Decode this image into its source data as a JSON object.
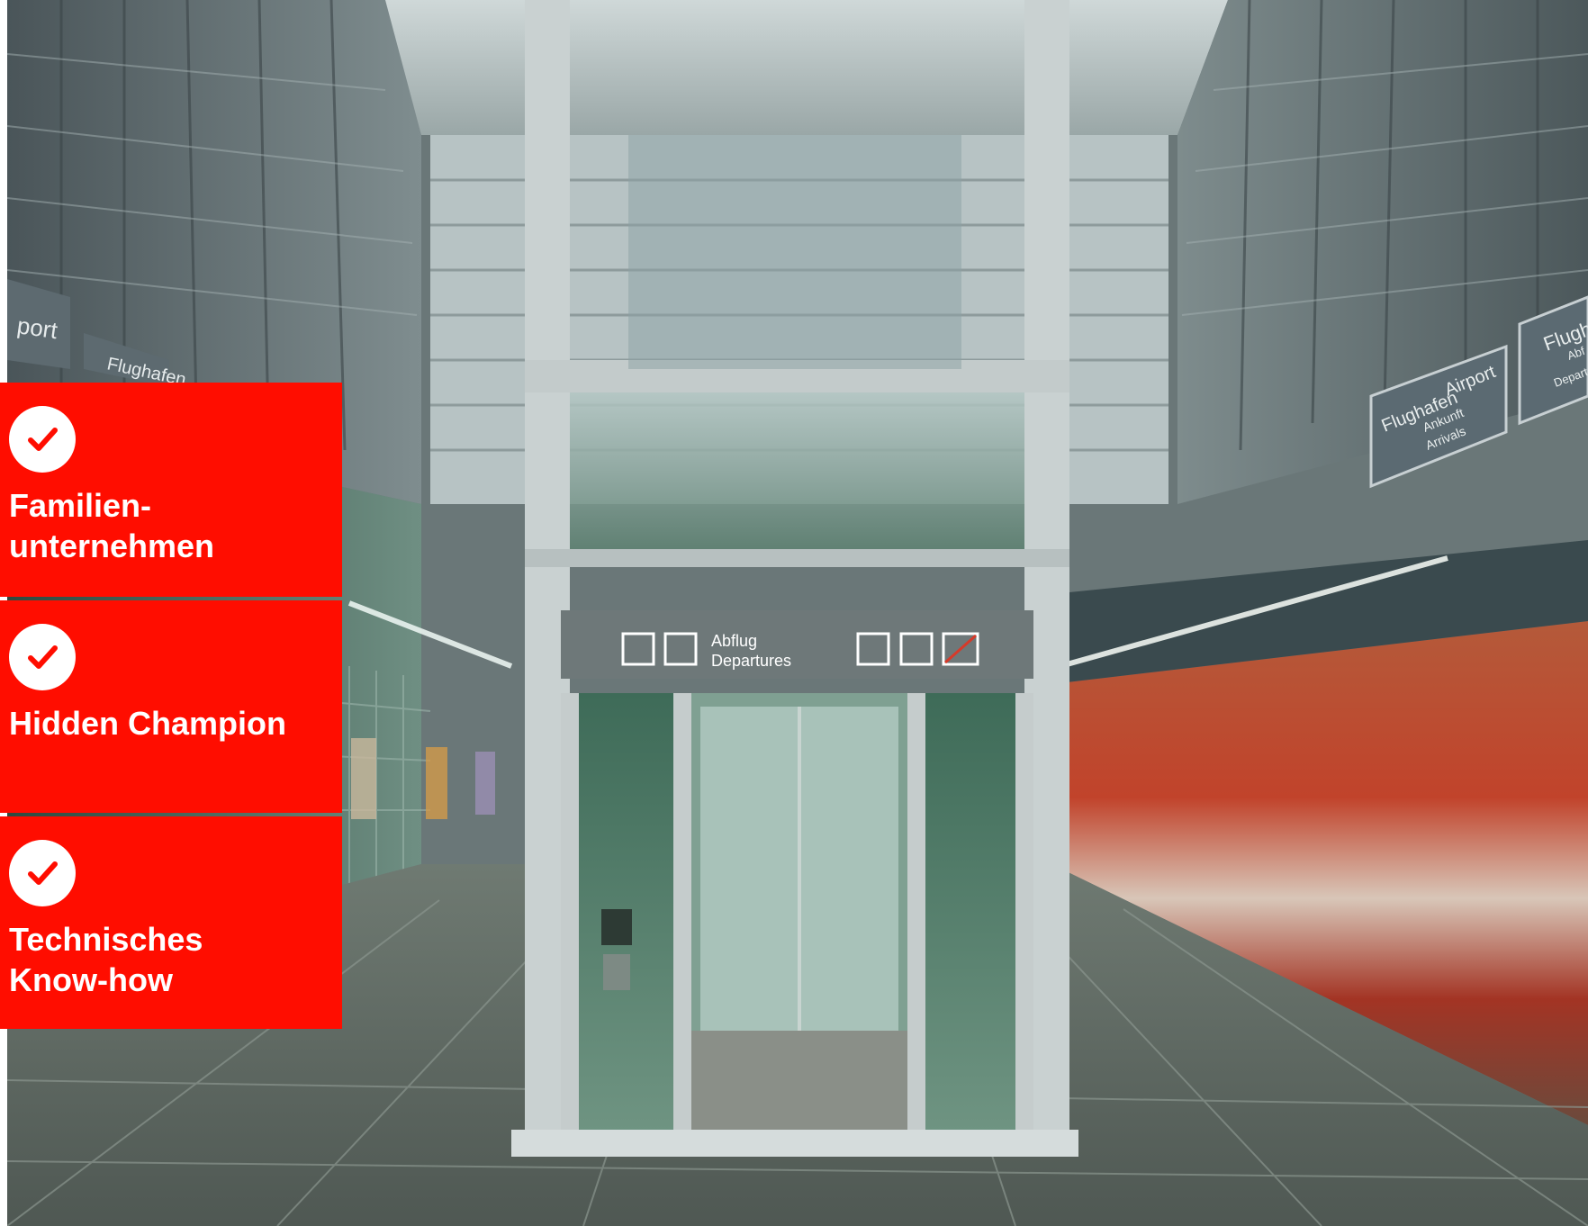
{
  "features": [
    {
      "title": "Familien-\nunternehmen",
      "icon": "check-circle-icon"
    },
    {
      "title": "Hidden Champion",
      "icon": "check-circle-icon"
    },
    {
      "title": "Technisches\nKnow-how",
      "icon": "check-circle-icon"
    }
  ],
  "signage": {
    "elevator_sign_line1": "Abflug",
    "elevator_sign_line2": "Departures",
    "left_wall_sign": "Flughafen",
    "left_wall_sign_b": "port",
    "right_sign_line1": "Flughafen",
    "right_sign_line2": "Airport",
    "right_sign_line3": "Ankunft",
    "right_sign_line4": "Arrivals",
    "right_edge_sign_a": "Flugha",
    "right_edge_sign_b": "Abf",
    "right_edge_sign_c": "Depart"
  },
  "colors": {
    "accent_red": "#ff0d00",
    "text_white": "#ffffff"
  }
}
